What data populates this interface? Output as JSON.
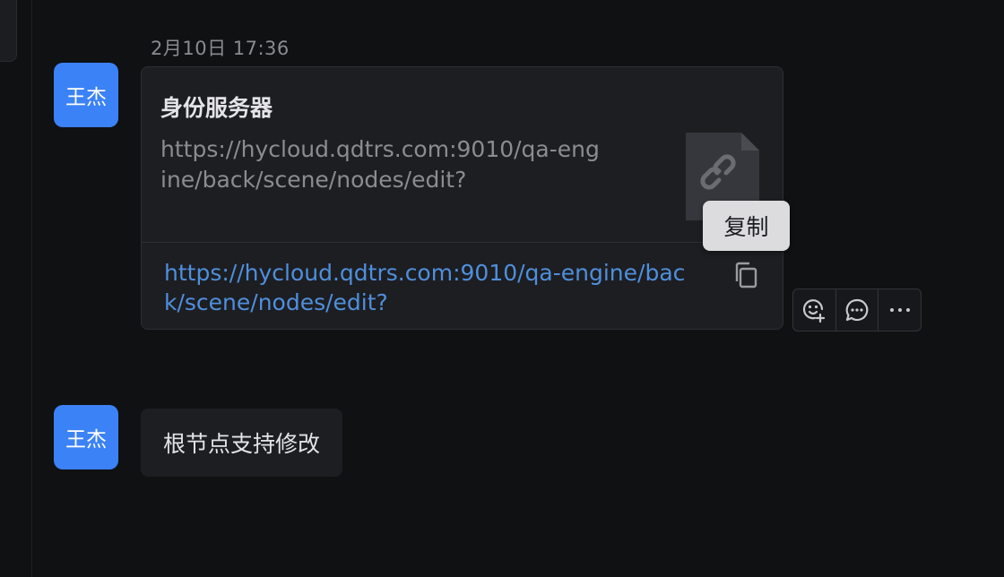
{
  "timestamp": "2月10日 17:36",
  "messages": [
    {
      "sender_avatar": "王杰",
      "type": "link-card",
      "card": {
        "title": "身份服务器",
        "description": "https://hycloud.qdtrs.com:9010/qa-engine/back/scene/nodes/edit?",
        "url": "https://hycloud.qdtrs.com:9010/qa-engine/back/scene/nodes/edit?",
        "thumb_icon": "link-icon",
        "copy_icon": "copy-icon"
      },
      "tooltip": "复制",
      "actions": [
        {
          "icon": "add-reaction-icon"
        },
        {
          "icon": "reply-comment-icon"
        },
        {
          "icon": "more-icon"
        }
      ]
    },
    {
      "sender_avatar": "王杰",
      "type": "text",
      "text": "根节点支持修改"
    }
  ],
  "colors": {
    "background": "#101113",
    "bubble": "#1d1e22",
    "avatar": "#3b82f6",
    "link": "#4f8fdc",
    "tooltip": "#dcdcde"
  }
}
